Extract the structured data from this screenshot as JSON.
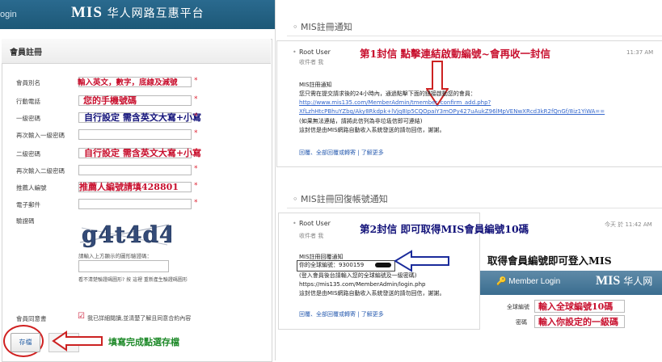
{
  "left": {
    "header": {
      "login_fragment": "ogin",
      "brand_en": "MIS",
      "brand_cn": "华人网路互惠平台"
    },
    "card_title": "會員註冊",
    "fields": [
      {
        "label": "會員別名",
        "hint": "輸入英文，數字，底線及減號"
      },
      {
        "label": "行動電話",
        "hint": "您的手機號碼"
      },
      {
        "label": "一級密碼",
        "hint": "自行設定 需含英文大寫+小寫"
      },
      {
        "label": "再次輸入一級密碼",
        "hint": ""
      },
      {
        "label": "二級密碼",
        "hint": "自行設定 需含英文大寫+小寫"
      },
      {
        "label": "再次輸入二級密碼",
        "hint": ""
      },
      {
        "label": "推薦人編號",
        "hint": "推薦人編號請填428801"
      },
      {
        "label": "電子郵件",
        "hint": ""
      }
    ],
    "required_mark": "*",
    "captcha_label": "驗證碼",
    "captcha_text": "g4t4d4",
    "captcha_instruction": "請輸入上方顯示的圖形驗證碼：",
    "captcha_help": "看不清楚驗證碼圖形? 按 這裡 重新產生驗證碼圖形",
    "agree_label": "會員同意書",
    "agree_check": "☑",
    "agree_text": "我已詳細閱讀,並清楚了解且同意合約內容",
    "save_button": "存檔",
    "save_note": "填寫完成點選存檔"
  },
  "right": {
    "notice1": {
      "section_title": "MIS註冊通知",
      "sender": "Root User",
      "recipient": "收件者 我",
      "annotation": "第1封信 點擊連結啟動編號~會再收一封信",
      "time": "11:37 AM",
      "lines": [
        "MIS註冊通知",
        "您只需在提交請求後的24小時內，通過點擊下面的鏈接啟動您的會員："
      ],
      "link1": "http://www.mis135.com/MemberAdmin/tmember_confirm_add.php?",
      "link2": "XfLzhHtcPBhuYZbq/Aky8Rkdpk+lVjq8Ip5CQOpaiY3mOPy427uAukZ96lMpVENwXRcd3kR2fQnGf/8iz1YiWA==",
      "after": [
        "(如果無法連結，請將此信列為非垃圾信即可連結)",
        "這封信是由MIS網路自動收入系統發送的請勿回信，謝謝。"
      ],
      "footer": "回覆、全部回覆或轉寄 | 了解更多"
    },
    "notice2": {
      "section_title": "MIS註冊回復帳號通知",
      "sender": "Root User",
      "recipient": "收件者 我",
      "annotation": "第2封信 即可取得MIS會員編號10碼",
      "time": "今天 於 11:42 AM",
      "line_title": "MIS註冊回覆通知",
      "member_no_label": "你的全球編號：9300159",
      "lines": [
        "(登入會員後台請輸入您的全球編號及一級密碼)",
        "https://mis135.com/MemberAdmin/login.php",
        "這封信是由MIS網路自動收入系統發送的請勿回信，謝謝。"
      ],
      "footer": "回覆、全部回覆或轉寄 | 了解更多"
    },
    "member_note": "取得會員編號即可登入MIS",
    "login_box": {
      "title": "Member Login",
      "brand_en": "MIS",
      "brand_cn": "华人网",
      "field1_label": "全球編號",
      "field1_hint": "輸入全球編號10碼",
      "field2_label": "密碼",
      "field2_hint": "輸入你設定的一級碼"
    }
  },
  "colors": {
    "header": "#1d5877",
    "annotation_red": "#c8102e",
    "annotation_blue": "#13137a",
    "link": "#3366cc"
  }
}
